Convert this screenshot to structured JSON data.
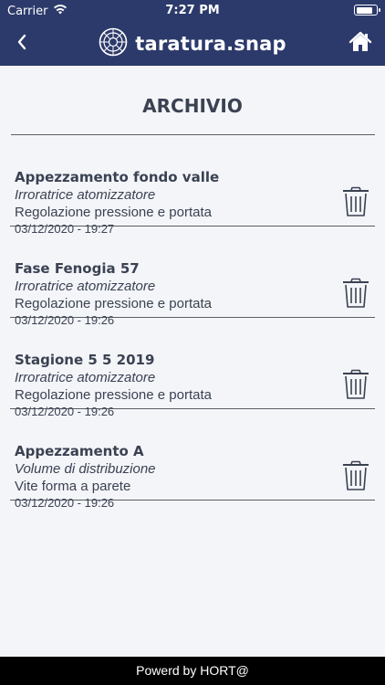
{
  "status_bar": {
    "carrier": "Carrier",
    "time": "7:27 PM",
    "battery_level": 0.85
  },
  "nav": {
    "back_icon": "chevron-left-icon",
    "logo_icon": "logo-icon",
    "brand": "taratura.snap",
    "home_icon": "home-icon"
  },
  "page": {
    "title": "ARCHIVIO"
  },
  "archive": {
    "items": [
      {
        "name": "Appezzamento fondo valle",
        "machine": "Irroratrice atomizzatore",
        "procedure": "Regolazione pressione e portata",
        "date": "03/12/2020 - 19:27"
      },
      {
        "name": "Fase Fenogia 57",
        "machine": "Irroratrice atomizzatore",
        "procedure": "Regolazione pressione e portata",
        "date": "03/12/2020 - 19:26"
      },
      {
        "name": "Stagione 5 5 2019",
        "machine": "Irroratrice atomizzatore",
        "procedure": "Regolazione pressione e portata",
        "date": "03/12/2020 - 19:26"
      },
      {
        "name": "Appezzamento A",
        "machine": "Volume di distribuzione",
        "procedure": "Vite forma a parete",
        "date": "03/12/2020 - 19:26"
      }
    ]
  },
  "footer": {
    "text": "Powerd by HORT@"
  },
  "colors": {
    "nav_background": "#2c3a6b",
    "text": "#3a4252",
    "divider": "#5a5f66",
    "page_background": "#f4f5f9",
    "footer_background": "#000000"
  }
}
